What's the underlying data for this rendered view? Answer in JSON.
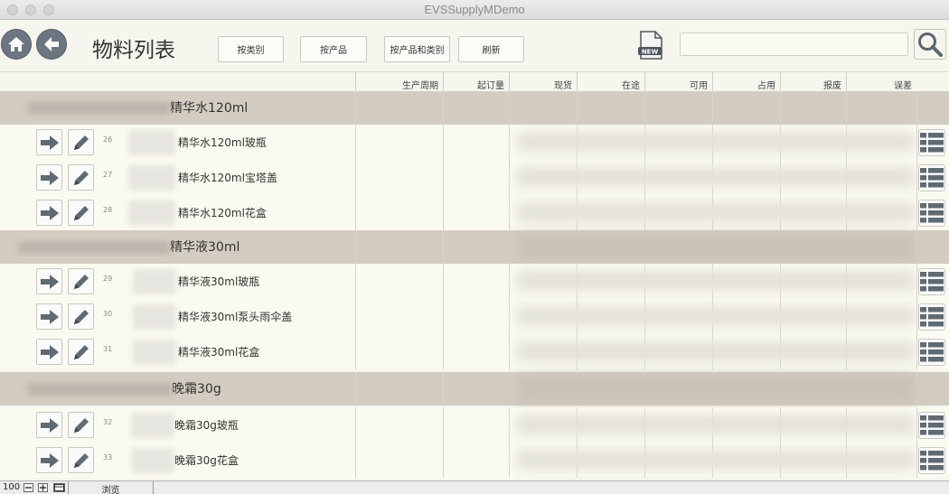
{
  "window": {
    "title": "EVSSupplyMDemo"
  },
  "toolbar": {
    "page_title": "物料列表",
    "btn_by_category": "按类别",
    "btn_by_product": "按产品",
    "btn_by_product_category": "按产品和类别",
    "btn_refresh": "刷新",
    "new_badge": "NEW",
    "search_value": ""
  },
  "columns": [
    "生产周期",
    "起订量",
    "现货",
    "在途",
    "可用",
    "占用",
    "报废",
    "误差"
  ],
  "groups": [
    {
      "label": "精华水120ml",
      "items": [
        {
          "num": "26",
          "name": "精华水120ml玻瓶"
        },
        {
          "num": "27",
          "name": "精华水120ml宝塔盖"
        },
        {
          "num": "28",
          "name": "精华水120ml花盒"
        }
      ]
    },
    {
      "label": "精华液30ml",
      "items": [
        {
          "num": "29",
          "name": "精华液30ml玻瓶"
        },
        {
          "num": "30",
          "name": "精华液30ml泵头雨伞盖"
        },
        {
          "num": "31",
          "name": "精华液30ml花盒"
        }
      ]
    },
    {
      "label": "晚霜30g",
      "items": [
        {
          "num": "32",
          "name": "晚霜30g玻瓶"
        },
        {
          "num": "33",
          "name": "晚霜30g花盒"
        }
      ]
    }
  ],
  "statusbar": {
    "zoom": "100",
    "mode": "浏览"
  },
  "colors": {
    "group_bg": "#d3ccc1",
    "row_bg": "#fbfaf0",
    "icon_dark": "#6a7680"
  }
}
